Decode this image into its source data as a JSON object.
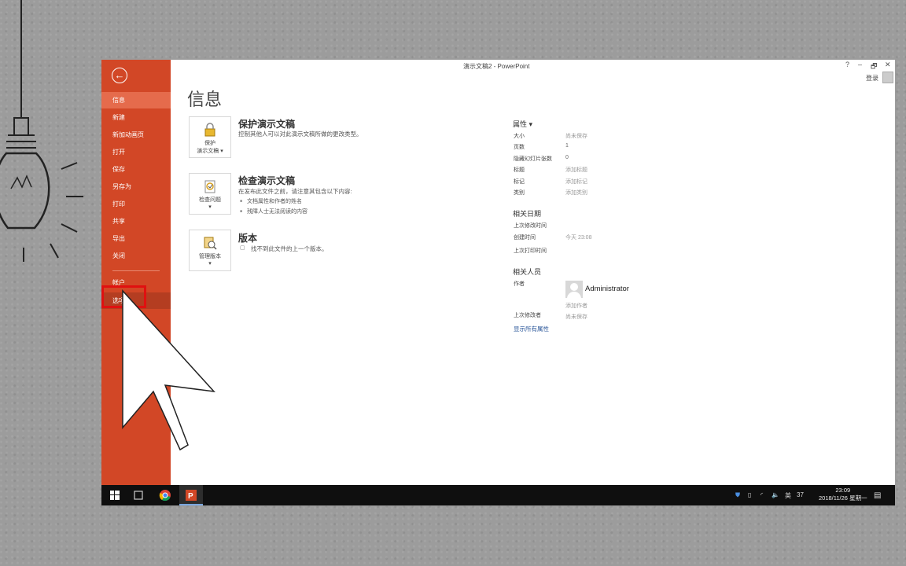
{
  "window": {
    "title": "演示文稿2 - PowerPoint",
    "help": "?",
    "minimize": "–",
    "restore": "🗗",
    "close": "✕",
    "signin": "登录"
  },
  "sidebar": {
    "back_icon": "back-arrow-icon",
    "items": [
      {
        "label": "信息",
        "state": "active"
      },
      {
        "label": "新建"
      },
      {
        "label": "新加动画页"
      },
      {
        "label": "打开"
      },
      {
        "label": "保存"
      },
      {
        "label": "另存为"
      },
      {
        "label": "打印"
      },
      {
        "label": "共享"
      },
      {
        "label": "导出"
      },
      {
        "label": "关闭"
      },
      {
        "label": "帐户"
      },
      {
        "label": "选项",
        "state": "hover"
      }
    ]
  },
  "main": {
    "title": "信息",
    "sections": [
      {
        "button_line1": "保护",
        "button_line2": "演示文稿 ▾",
        "title": "保护演示文稿",
        "desc": "控制其他人可以对此演示文稿所做的更改类型。"
      },
      {
        "button_line1": "检查问题",
        "button_line2": "▾",
        "title": "检查演示文稿",
        "desc": "在发布此文件之前，请注意其包含以下内容:",
        "bullets": [
          "文档属性和作者的姓名",
          "残障人士无法阅读的内容"
        ]
      },
      {
        "button_line1": "管理版本",
        "button_line2": "▾",
        "title": "版本",
        "desc": "找不到此文件的上一个版本。"
      }
    ]
  },
  "properties": {
    "header": "属性 ▾",
    "rows": [
      {
        "label": "大小",
        "value": "尚未保存"
      },
      {
        "label": "页数",
        "value": "1"
      },
      {
        "label": "隐藏幻灯片张数",
        "value": "0"
      },
      {
        "label": "标题",
        "value": "添加标题"
      },
      {
        "label": "标记",
        "value": "添加标记"
      },
      {
        "label": "类别",
        "value": "添加类别"
      }
    ],
    "dates_header": "相关日期",
    "dates": [
      {
        "label": "上次修改时间",
        "value": ""
      },
      {
        "label": "创建时间",
        "value": "今天 23:08"
      },
      {
        "label": "上次打印时间",
        "value": ""
      }
    ],
    "people_header": "相关人员",
    "author_label": "作者",
    "author_name": "Administrator",
    "add_author": "添加作者",
    "last_modified_by_label": "上次修改者",
    "last_modified_by_value": "尚未保存",
    "show_all": "显示所有属性"
  },
  "taskbar": {
    "tray_lang": "英",
    "tray_num": "37",
    "time": "23:09",
    "date": "2018/11/26 星期一"
  },
  "colors": {
    "accent": "#d24726",
    "taskbar": "#0f0f0f",
    "highlight": "#e01010"
  }
}
